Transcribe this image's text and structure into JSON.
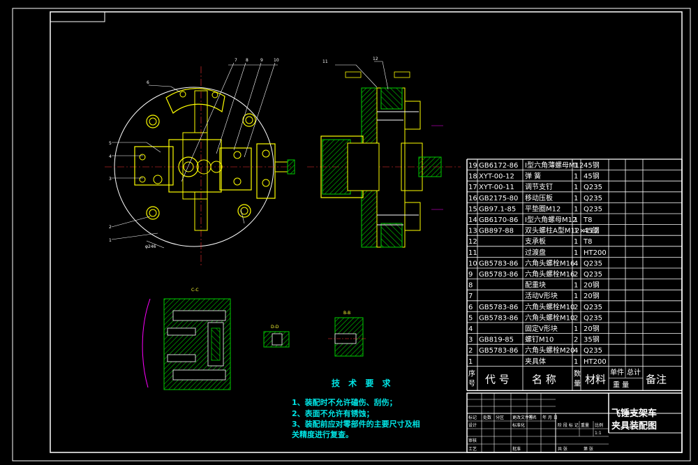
{
  "bom": {
    "rows": [
      {
        "no": "19",
        "code": "GB6172-86",
        "name": "I型六角薄螺母M12",
        "qty": "1",
        "mat": "45钢"
      },
      {
        "no": "18",
        "code": "XYT-00-12",
        "name": "弹 簧",
        "qty": "1",
        "mat": "45钢"
      },
      {
        "no": "17",
        "code": "XYT-00-11",
        "name": "调节支钉",
        "qty": "1",
        "mat": "Q235"
      },
      {
        "no": "16",
        "code": "GB2175-80",
        "name": "移动压板",
        "qty": "1",
        "mat": "Q235"
      },
      {
        "no": "15",
        "code": "GB97.1-85",
        "name": "平垫圈M12",
        "qty": "1",
        "mat": "Q235"
      },
      {
        "no": "14",
        "code": "GB6170-86",
        "name": "I型六角螺母M12",
        "qty": "1",
        "mat": "T8"
      },
      {
        "no": "13",
        "code": "GB897-88",
        "name": "双头螺柱A型M12×112",
        "qty": "1",
        "mat": "45钢"
      },
      {
        "no": "12",
        "code": "",
        "name": "支承板",
        "qty": "1",
        "mat": "T8"
      },
      {
        "no": "11",
        "code": "",
        "name": "过渡盘",
        "qty": "1",
        "mat": "HT200"
      },
      {
        "no": "10",
        "code": "GB5783-86",
        "name": "六角头螺栓M16",
        "qty": "4",
        "mat": "Q235"
      },
      {
        "no": "9",
        "code": "GB5783-86",
        "name": "六角头螺栓M16",
        "qty": "2",
        "mat": "Q235"
      },
      {
        "no": "8",
        "code": "",
        "name": "配重块",
        "qty": "1",
        "mat": "20钢"
      },
      {
        "no": "7",
        "code": "",
        "name": "活动V形块",
        "qty": "1",
        "mat": "20钢"
      },
      {
        "no": "6",
        "code": "GB5783-86",
        "name": "六角头螺栓M10",
        "qty": "2",
        "mat": "Q235"
      },
      {
        "no": "5",
        "code": "GB5783-86",
        "name": "六角头螺栓M10",
        "qty": "2",
        "mat": "Q235"
      },
      {
        "no": "4",
        "code": "",
        "name": "固定V形块",
        "qty": "1",
        "mat": "20钢"
      },
      {
        "no": "3",
        "code": "GB819-85",
        "name": "螺钉M10",
        "qty": "2",
        "mat": "35钢"
      },
      {
        "no": "2",
        "code": "GB5783-86",
        "name": "六角头螺栓M20",
        "qty": "4",
        "mat": "Q235"
      },
      {
        "no": "1",
        "code": "",
        "name": "夹具体",
        "qty": "1",
        "mat": "HT200"
      }
    ],
    "header": {
      "no": "序号",
      "code": "代 号",
      "name": "名 称",
      "qty": "数量",
      "mat": "材料",
      "unit": "单件",
      "total": "总计",
      "weight": "重 量",
      "remark": "备注"
    }
  },
  "title_block": {
    "title_line1": "飞锤支架车",
    "title_line2": "夹具装配图",
    "cells": [
      "标记",
      "处数",
      "分区",
      "更改文件号",
      "签名",
      "年 月 日",
      "设计",
      "标准化",
      "阶 段 标 记",
      "重量",
      "比例",
      "审核",
      "工艺",
      "批准",
      "共 张",
      "第 张",
      "1:1"
    ]
  },
  "tech_req": {
    "title": "技 术 要 求",
    "items": [
      "1、装配时不允许磕伤、刮伤；",
      "2、表面不允许有锈蚀；",
      "3、装配前应对零部件的主要尺寸及相",
      "关精度进行复查。"
    ]
  },
  "section_labels": {
    "cc": "C-C",
    "dd": "D-D",
    "bb": "B-B"
  },
  "leader_numbers": [
    "1",
    "2",
    "3",
    "4",
    "5",
    "6",
    "7",
    "8",
    "9",
    "10",
    "11",
    "12"
  ],
  "colors": {
    "background": "#000000",
    "lines": "#ffffff",
    "parts": "#ffff00",
    "hatch": "#00cc00",
    "req_text": "#00e5e5",
    "dim": "#ff00ff",
    "centerline": "#ff3333"
  }
}
